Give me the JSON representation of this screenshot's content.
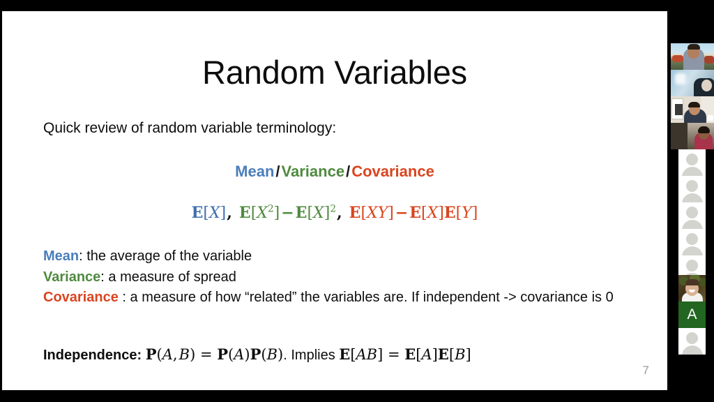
{
  "slide": {
    "title": "Random Variables",
    "intro": "Quick review of random variable terminology:",
    "terms": {
      "mean": "Mean",
      "variance": "Variance",
      "covariance": "Covariance",
      "separator": "/"
    },
    "formula": {
      "mean_expr": "E[X]",
      "variance_expr": "E[X²] −E[X]²",
      "covariance_expr": "E[XY] − E[X]E[Y]",
      "comma": ","
    },
    "definitions": [
      {
        "term": "Mean",
        "punct": ":",
        "text": " the average of the variable"
      },
      {
        "term": "Variance",
        "punct": ":",
        "text": " a measure of spread"
      },
      {
        "term": "Covariance",
        "punct": " :",
        "text": " a measure of how “related” the variables are. If independent -> covariance is 0"
      }
    ],
    "independence": {
      "label": "Independence:",
      "equation": "P(A, B) = P(A)P(B)",
      "period": ".",
      "implies": "Implies",
      "implication": "E[AB] = E[A]E[B]"
    },
    "page_number": "7",
    "colors": {
      "mean": "#4a7ebb",
      "variance": "#4f8a3e",
      "covariance": "#d9451f",
      "text": "#0d0d0d",
      "page_number": "#9a9a9a",
      "slide_background": "#ffffff"
    }
  },
  "filmstrip": {
    "background": "#000000",
    "letter_tile": {
      "letter": "A",
      "background": "#226622",
      "text_color": "#ffffff"
    },
    "tiles": [
      {
        "kind": "video",
        "style": "v1"
      },
      {
        "kind": "video",
        "style": "v2"
      },
      {
        "kind": "video",
        "style": "v3"
      },
      {
        "kind": "video",
        "style": "v4"
      },
      {
        "kind": "placeholder"
      },
      {
        "kind": "placeholder"
      },
      {
        "kind": "placeholder"
      },
      {
        "kind": "placeholder"
      },
      {
        "kind": "placeholder"
      },
      {
        "kind": "video",
        "style": "v5"
      },
      {
        "kind": "letter"
      },
      {
        "kind": "placeholder"
      }
    ]
  }
}
